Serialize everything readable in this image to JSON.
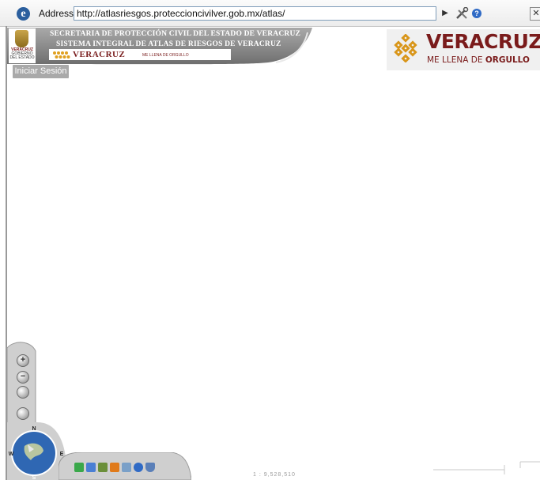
{
  "browser": {
    "address_label": "Address:",
    "url": "http://atlasriesgos.proteccioncivilver.gob.mx/atlas/",
    "go_icon": "play-arrow-icon",
    "tools_icon": "tools-icon",
    "help_icon": "help-icon",
    "close_label": "✕"
  },
  "banner": {
    "line1": "SECRETARIA DE PROTECCIÓN CIVIL DEL ESTADO DE VERACRUZ",
    "line2": "SISTEMA INTEGRAL DE ATLAS DE RIESGOS DE VERACRUZ",
    "seal_title": "VERACRUZ",
    "seal_sub1": "GOBIERNO",
    "seal_sub2": "DEL ESTADO",
    "mini_brand": "VERACRUZ",
    "mini_slogan": "ME LLENA DE ORGULLO"
  },
  "login": {
    "label": "Iniciar Sesión"
  },
  "brand": {
    "title": "VERACRUZ",
    "subtitle_prefix": "ME LLENA DE ",
    "subtitle_bold": "ORGULLO"
  },
  "map_nav": {
    "zoom_in": "+",
    "zoom_out": "−",
    "compass": {
      "n": "N",
      "s": "S",
      "e": "E",
      "w": "W"
    }
  },
  "toolbar": {
    "icons": [
      "layers-icon",
      "legend-icon",
      "stack-icon",
      "rss-icon",
      "measure-icon",
      "info-icon",
      "shield-icon"
    ]
  },
  "scale_text": "1 : 9,528,510",
  "colors": {
    "brand_red": "#7a1b1b",
    "banner_gray": "#8a8a8a",
    "login_gray": "#a9a9a9"
  }
}
